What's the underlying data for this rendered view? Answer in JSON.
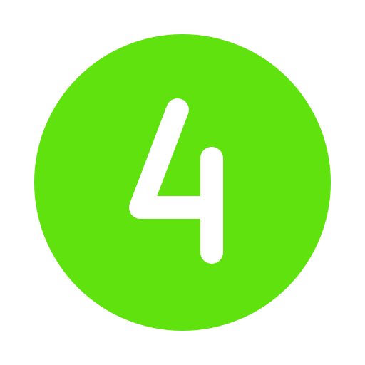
{
  "icon": {
    "name": "number-four-circle-icon",
    "digit": "4",
    "colors": {
      "circle": "#60e20e",
      "glyph": "#ffffff"
    }
  }
}
